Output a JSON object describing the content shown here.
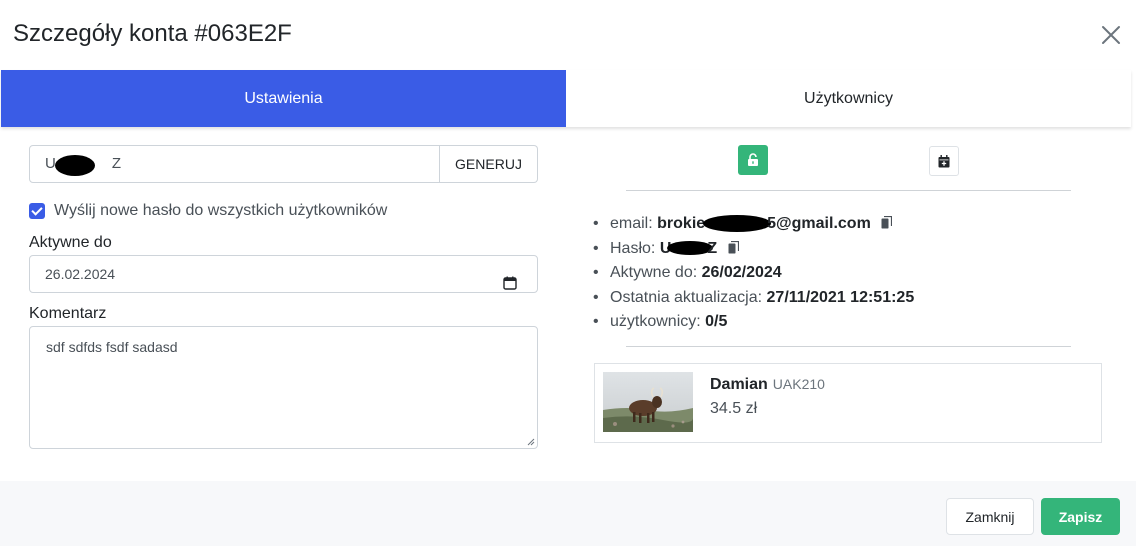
{
  "modal": {
    "title": "Szczegóły konta #063E2F"
  },
  "tabs": [
    {
      "label": "Ustawienia",
      "active": true
    },
    {
      "label": "Użytkownicy",
      "active": false
    }
  ],
  "form": {
    "password_prefix": "U",
    "password_suffix": "Z",
    "generate_label": "GENERUJ",
    "send_checkbox_label": "Wyślij nowe hasło do wszystkich użytkowników",
    "send_checked": true,
    "active_label": "Aktywne do",
    "active_value": "26.02.2024",
    "comment_label": "Komentarz",
    "comment_value": "sdf sdfds fsdf sadasd"
  },
  "info": {
    "email_label": "email:",
    "email_prefix": "brokie",
    "email_suffix": "5@gmail.com",
    "password_label": "Hasło:",
    "password_prefix": "U",
    "password_suffix": "Z",
    "active_label": "Aktywne do:",
    "active_value": "26/02/2024",
    "updated_label": "Ostatnia aktualizacja:",
    "updated_value": "27/11/2021 12:51:25",
    "users_label": "użytkownicy:",
    "users_value": "0/5"
  },
  "user_card": {
    "name": "Damian",
    "code": "UAK210",
    "price": "34.5 zł"
  },
  "footer": {
    "close_label": "Zamknij",
    "save_label": "Zapisz"
  },
  "colors": {
    "primary": "#3a5ce6",
    "success": "#34b57a"
  },
  "icons": [
    "close-icon",
    "unlock-icon",
    "calendar-plus-icon",
    "calendar-icon",
    "copy-icon"
  ]
}
